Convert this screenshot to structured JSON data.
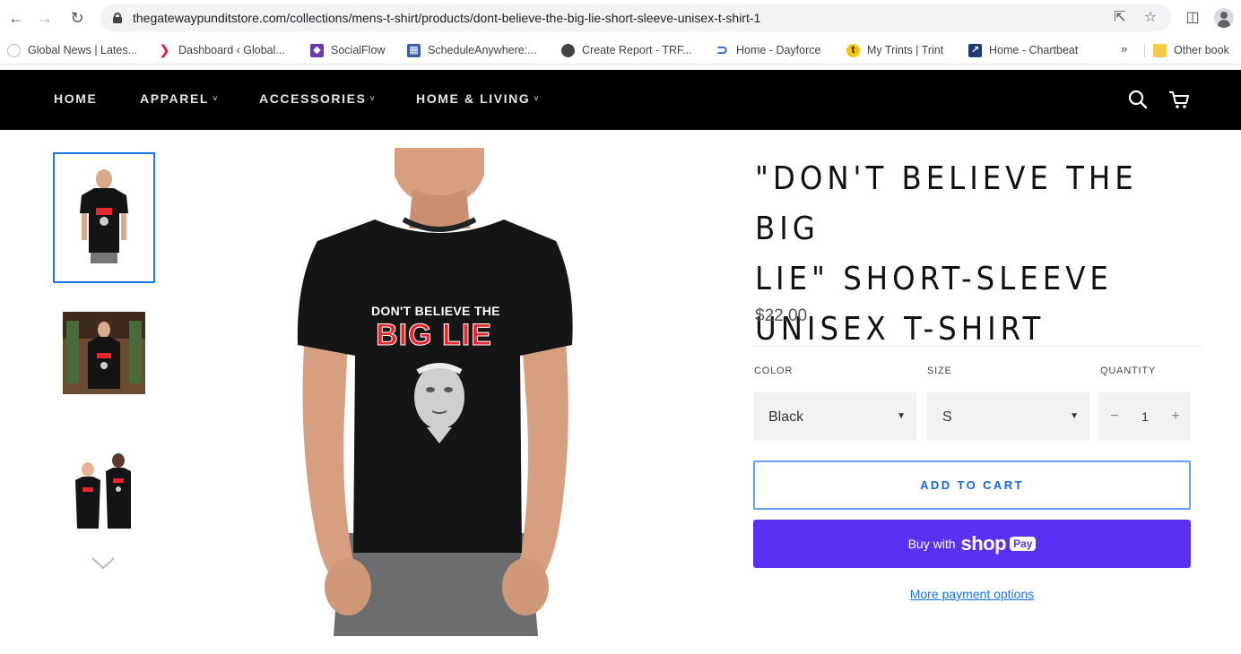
{
  "browser": {
    "url": "thegatewaypunditstore.com/collections/mens-t-shirt/products/dont-believe-the-big-lie-short-sleeve-unisex-t-shirt-1",
    "nav_icons": [
      "back-arrow-icon",
      "forward-arrow-icon",
      "reload-icon"
    ],
    "bookmarks": [
      {
        "label": "Global News | Lates...",
        "icon": "globe-icon"
      },
      {
        "label": "Dashboard ‹ Global...",
        "icon": "red-arrow-icon",
        "color": "#e31837"
      },
      {
        "label": "SocialFlow",
        "icon": "socialflow-icon",
        "color": "#6a3aa8"
      },
      {
        "label": "ScheduleAnywhere:...",
        "icon": "schedule-icon",
        "color": "#3b5aa8"
      },
      {
        "label": "Create Report - TRF...",
        "icon": "globe-icon"
      },
      {
        "label": "Home - Dayforce",
        "icon": "dayforce-icon",
        "color": "#1b5fcf"
      },
      {
        "label": "My Trints | Trint",
        "icon": "trint-icon",
        "color": "#f5c400"
      },
      {
        "label": "Home - Chartbeat",
        "icon": "chartbeat-icon",
        "color": "#1e3a6e"
      }
    ],
    "bookmarks_more": "»",
    "other_bookmarks": "Other book"
  },
  "store_nav": {
    "items": [
      {
        "label": "HOME",
        "has_caret": false
      },
      {
        "label": "APPAREL",
        "has_caret": true
      },
      {
        "label": "ACCESSORIES",
        "has_caret": true
      },
      {
        "label": "HOME & LIVING",
        "has_caret": true
      }
    ],
    "caret": "˅",
    "icons": [
      "search-icon",
      "cart-icon"
    ]
  },
  "gallery": {
    "thumbnails": [
      {
        "name": "thumbnail-1",
        "selected": true
      },
      {
        "name": "thumbnail-2",
        "selected": false
      },
      {
        "name": "thumbnail-3",
        "selected": false
      }
    ],
    "shirt_text_line1": "DON'T BELIEVE THE",
    "shirt_text_line2": "BIG LIE"
  },
  "product": {
    "title_lines": [
      "\"DON'T BELIEVE THE BIG",
      "LIE\" SHORT-SLEEVE",
      "UNISEX T-SHIRT"
    ],
    "price": "$22.00",
    "options": {
      "color_label": "COLOR",
      "color_value": "Black",
      "size_label": "SIZE",
      "size_value": "S",
      "quantity_label": "QUANTITY",
      "quantity_value": "1",
      "minus": "−",
      "plus": "+"
    },
    "add_to_cart": "ADD TO CART",
    "shop_pay": {
      "buy_with": "Buy with",
      "shop": "shop",
      "pay": "Pay"
    },
    "more_payment": "More payment options"
  },
  "colors": {
    "nav_bg": "#000000",
    "accent_blue": "#1565e6",
    "shop_pay_purple": "#5a31f4",
    "thumbnail_selected_border": "#1a73e8"
  }
}
